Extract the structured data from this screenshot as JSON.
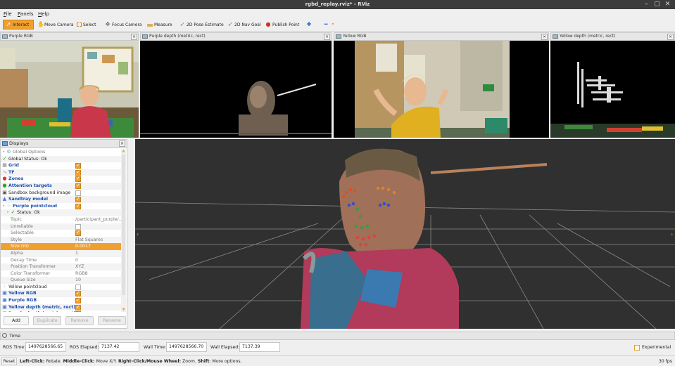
{
  "window": {
    "title": "rgbd_replay.rviz* - RViz"
  },
  "menu": [
    {
      "accel": "F",
      "rest": "ile"
    },
    {
      "accel": "P",
      "rest": "anels"
    },
    {
      "accel": "H",
      "rest": "elp"
    }
  ],
  "toolbar": {
    "interact": "Interact",
    "move_camera": "Move Camera",
    "select": "Select",
    "focus_camera": "Focus Camera",
    "measure": "Measure",
    "pose_estimate": "2D Pose Estimate",
    "nav_goal": "2D Nav Goal",
    "publish_point": "Publish Point"
  },
  "panels": {
    "purple_rgb": "Purple RGB",
    "purple_depth": "Purple depth (metric, rect)",
    "yellow_rgb": "Yellow RGB",
    "yellow_depth": "Yellow depth (metric, rect)"
  },
  "displays": {
    "title": "Displays",
    "rows": [
      {
        "label": "Global Options",
        "style": "grey"
      },
      {
        "label": "Global Status: Ok",
        "style": ""
      },
      {
        "label": "Grid",
        "style": "blue",
        "checked": true
      },
      {
        "label": "TF",
        "style": "blue",
        "checked": true
      },
      {
        "label": "Zones",
        "style": "blue",
        "checked": true
      },
      {
        "label": "Attention targets",
        "style": "blue",
        "checked": true
      },
      {
        "label": "Sandbox background image",
        "style": "",
        "checked": false
      },
      {
        "label": "Sandtray model",
        "style": "blue",
        "checked": true
      },
      {
        "label": "Purple pointcloud",
        "style": "blue",
        "checked": true
      },
      {
        "label": "Status: Ok",
        "style": ""
      },
      {
        "label": "Topic",
        "style": "grey",
        "value": "/participant_purple/..."
      },
      {
        "label": "Unreliable",
        "style": "grey",
        "checked": false
      },
      {
        "label": "Selectable",
        "style": "grey",
        "checked": true
      },
      {
        "label": "Style",
        "style": "grey",
        "value": "Flat Squares"
      },
      {
        "label": "Size (m)",
        "style": "",
        "value": "0.0017"
      },
      {
        "label": "Alpha",
        "style": "grey",
        "value": "1"
      },
      {
        "label": "Decay Time",
        "style": "grey",
        "value": "0"
      },
      {
        "label": "Position Transformer",
        "style": "grey",
        "value": "XYZ"
      },
      {
        "label": "Color Transformer",
        "style": "grey",
        "value": "RGB8"
      },
      {
        "label": "Queue Size",
        "style": "grey",
        "value": "10"
      },
      {
        "label": "Yellow pointcloud",
        "style": "",
        "checked": false
      },
      {
        "label": "Yellow RGB",
        "style": "blue",
        "checked": true
      },
      {
        "label": "Purple RGB",
        "style": "blue",
        "checked": true
      },
      {
        "label": "Yellow depth (metric, rect)",
        "style": "blue",
        "checked": true
      },
      {
        "label": "Purple depth (metric, rect)",
        "style": "blue",
        "checked": true
      }
    ],
    "buttons": {
      "add": "Add",
      "duplicate": "Duplicate",
      "remove": "Remove",
      "rename": "Rename"
    }
  },
  "time": {
    "title": "Time",
    "ros_time_label": "ROS Time:",
    "ros_time": "1497628566.65",
    "ros_elapsed_label": "ROS Elapsed:",
    "ros_elapsed": "7137.42",
    "wall_time_label": "Wall Time:",
    "wall_time": "1497628566.70",
    "wall_elapsed_label": "Wall Elapsed:",
    "wall_elapsed": "7137.39",
    "experimental": "Experimental"
  },
  "status": {
    "reset": "Reset",
    "hint_parts": [
      {
        "b": "Left-Click:",
        "t": " Rotate. "
      },
      {
        "b": "Middle-Click:",
        "t": " Move X/Y. "
      },
      {
        "b": "Right-Click/Mouse Wheel:",
        "t": " Zoom. "
      },
      {
        "b": "Shift",
        "t": ": More options."
      }
    ],
    "fps": "30 fps"
  },
  "colors": {
    "accent": "#f0a030",
    "titlebar": "#3c3c3c",
    "link_blue": "#1d4fb0",
    "view_bg": "#303030"
  }
}
